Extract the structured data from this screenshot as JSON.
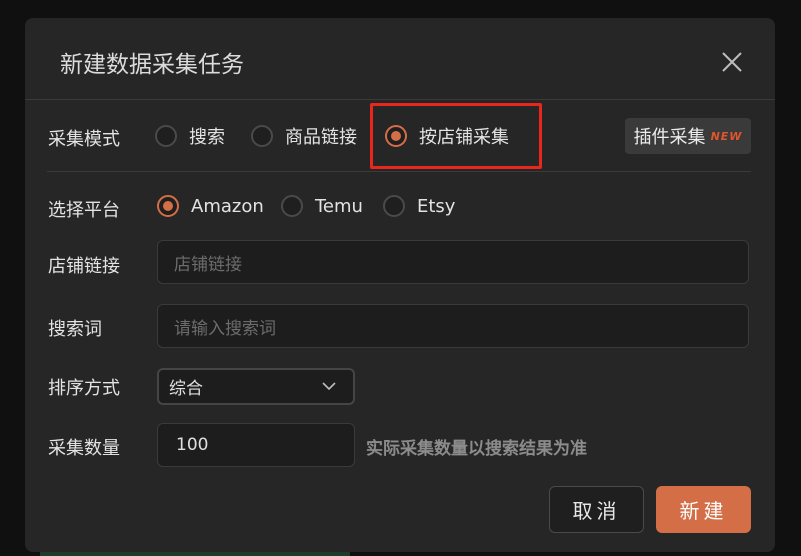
{
  "dialog": {
    "title": "新建数据采集任务"
  },
  "collect_mode": {
    "label": "采集模式",
    "options": [
      {
        "label": "搜索",
        "checked": false
      },
      {
        "label": "商品链接",
        "checked": false
      },
      {
        "label": "按店铺采集",
        "checked": true
      }
    ],
    "plugin_button": {
      "label": "插件采集",
      "tag": "NEW"
    }
  },
  "platform": {
    "label": "选择平台",
    "options": [
      {
        "label": "Amazon",
        "checked": true
      },
      {
        "label": "Temu",
        "checked": false
      },
      {
        "label": "Etsy",
        "checked": false
      }
    ]
  },
  "store_link": {
    "label": "店铺链接",
    "placeholder": "店铺链接",
    "value": ""
  },
  "search_term": {
    "label": "搜索词",
    "placeholder": "请输入搜索词",
    "value": ""
  },
  "sort": {
    "label": "排序方式",
    "selected": "综合"
  },
  "quantity": {
    "label": "采集数量",
    "value": "100",
    "hint": "实际采集数量以搜索结果为准"
  },
  "footer": {
    "cancel": "取消",
    "create": "新建"
  },
  "colors": {
    "accent": "#d36e47",
    "highlight": "#e8261c",
    "dialog_bg": "#262626"
  }
}
